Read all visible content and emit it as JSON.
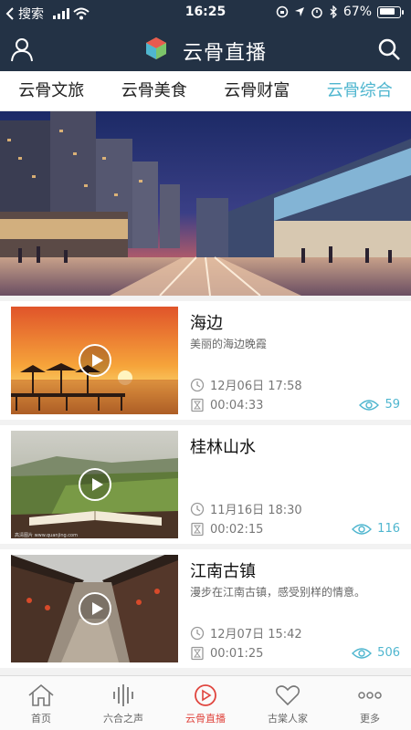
{
  "status_bar": {
    "back_label": "搜索",
    "time": "16:25",
    "battery": "67%"
  },
  "header": {
    "title": "云骨直播"
  },
  "tabs": [
    {
      "label": "云骨文旅",
      "active": false
    },
    {
      "label": "云骨美食",
      "active": false
    },
    {
      "label": "云骨财富",
      "active": false
    },
    {
      "label": "云骨综合",
      "active": true
    }
  ],
  "videos": [
    {
      "title": "海边",
      "description": "美丽的海边晚霞",
      "date": "12月06日 17:58",
      "duration": "00:04:33",
      "views": "59"
    },
    {
      "title": "桂林山水",
      "description": "",
      "date": "11月16日 18:30",
      "duration": "00:02:15",
      "views": "116"
    },
    {
      "title": "江南古镇",
      "description": "漫步在江南古镇，感受别样的情意。",
      "date": "12月07日 15:42",
      "duration": "00:01:25",
      "views": "506"
    }
  ],
  "bottom_nav": [
    {
      "label": "首页",
      "icon": "home-icon",
      "active": false
    },
    {
      "label": "六合之声",
      "icon": "audio-wave-icon",
      "active": false
    },
    {
      "label": "云骨直播",
      "icon": "play-circle-icon",
      "active": true
    },
    {
      "label": "古棠人家",
      "icon": "heart-icon",
      "active": false
    },
    {
      "label": "更多",
      "icon": "more-icon",
      "active": false
    }
  ],
  "colors": {
    "header_bg": "#233245",
    "accent": "#4fb6cf",
    "active_nav": "#e0453e"
  }
}
